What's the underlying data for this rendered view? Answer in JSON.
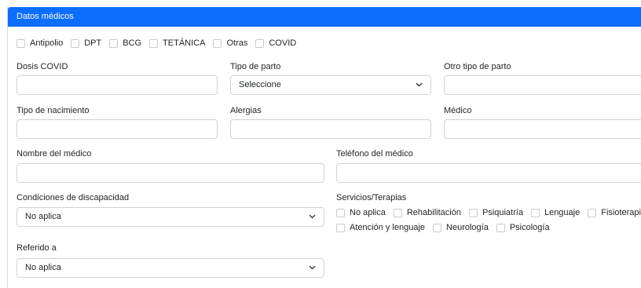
{
  "section_title": "Datos médicos",
  "vaccines": [
    "Antipolio",
    "DPT",
    "BCG",
    "TETÁNICA",
    "Otras",
    "COVID"
  ],
  "fields": {
    "dosis_covid": {
      "label": "Dosis COVID",
      "value": ""
    },
    "tipo_parto": {
      "label": "Tipo de parto",
      "value": "Seleccione"
    },
    "otro_tipo_parto": {
      "label": "Otro tipo de parto",
      "value": ""
    },
    "tipo_nacimiento": {
      "label": "Tipo de nacimiento",
      "value": ""
    },
    "alergias": {
      "label": "Alergias",
      "value": ""
    },
    "medico": {
      "label": "Médico",
      "value": ""
    },
    "nombre_medico": {
      "label": "Nombre del médico",
      "value": ""
    },
    "telefono_medico": {
      "label": "Teléfono del médico",
      "value": ""
    },
    "condiciones_discapacidad": {
      "label": "Condiciones de discapacidad",
      "value": "No aplica"
    },
    "referido_a": {
      "label": "Referido a",
      "value": "No aplica"
    }
  },
  "servicios": {
    "label": "Servicios/Terapias",
    "row1": [
      "No aplica",
      "Rehabilitación",
      "Psiquiatría",
      "Lenguaje",
      "Fisioterapia"
    ],
    "row2": [
      "Atención y lenguaje",
      "Neurología",
      "Psicología"
    ]
  },
  "colors": {
    "header_bg": "#0d6efd",
    "border": "#ced4da"
  }
}
